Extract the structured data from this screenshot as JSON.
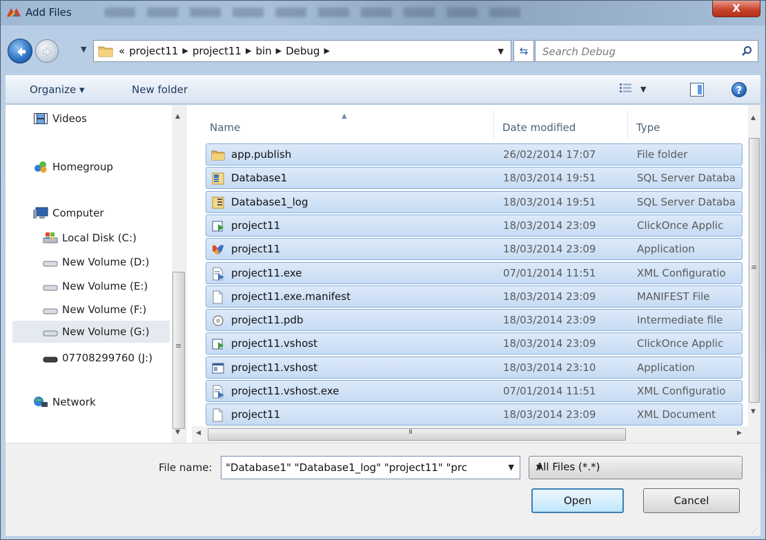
{
  "window": {
    "title": "Add Files",
    "close_label": "X"
  },
  "address": {
    "overflow": "«",
    "crumbs": [
      "project11",
      "project11",
      "bin",
      "Debug"
    ],
    "separator": "▶"
  },
  "search": {
    "placeholder": "Search Debug"
  },
  "toolbar": {
    "organize_label": "Organize ▾",
    "new_folder_label": "New folder",
    "help_label": "?"
  },
  "nav": {
    "items": [
      {
        "label": "Videos",
        "icon": "videos-icon"
      },
      {
        "label": "Homegroup",
        "icon": "homegroup-icon"
      },
      {
        "label": "Computer",
        "icon": "computer-icon"
      },
      {
        "label": "Local Disk (C:)",
        "icon": "local-disk-icon"
      },
      {
        "label": "New Volume (D:)",
        "icon": "drive-icon"
      },
      {
        "label": "New Volume (E:)",
        "icon": "drive-icon"
      },
      {
        "label": "New Volume (F:)",
        "icon": "drive-icon"
      },
      {
        "label": "New Volume (G:)",
        "icon": "drive-icon",
        "selected": true
      },
      {
        "label": "07708299760 (J:)",
        "icon": "removable-drive-icon"
      },
      {
        "label": "Network",
        "icon": "network-icon"
      }
    ]
  },
  "list": {
    "columns": {
      "name": "Name",
      "date": "Date modified",
      "type": "Type"
    },
    "rows": [
      {
        "name": "app.publish",
        "date": "26/02/2014 17:07",
        "type": "File folder",
        "icon": "folder-icon"
      },
      {
        "name": "Database1",
        "date": "18/03/2014 19:51",
        "type": "SQL Server Databa",
        "icon": "database-icon"
      },
      {
        "name": "Database1_log",
        "date": "18/03/2014 19:51",
        "type": "SQL Server Databa",
        "icon": "database-log-icon"
      },
      {
        "name": "project11",
        "date": "18/03/2014 23:09",
        "type": "ClickOnce Applic",
        "icon": "clickonce-icon"
      },
      {
        "name": "project11",
        "date": "18/03/2014 23:09",
        "type": "Application",
        "icon": "application-icon"
      },
      {
        "name": "project11.exe",
        "date": "07/01/2014 11:51",
        "type": "XML Configuratio",
        "icon": "config-file-icon"
      },
      {
        "name": "project11.exe.manifest",
        "date": "18/03/2014 23:09",
        "type": "MANIFEST File",
        "icon": "blank-file-icon"
      },
      {
        "name": "project11.pdb",
        "date": "18/03/2014 23:09",
        "type": "Intermediate file",
        "icon": "pdb-file-icon"
      },
      {
        "name": "project11.vshost",
        "date": "18/03/2014 23:09",
        "type": "ClickOnce Applic",
        "icon": "clickonce-icon"
      },
      {
        "name": "project11.vshost",
        "date": "18/03/2014 23:10",
        "type": "Application",
        "icon": "window-app-icon"
      },
      {
        "name": "project11.vshost.exe",
        "date": "07/01/2014 11:51",
        "type": "XML Configuratio",
        "icon": "config-file-icon"
      },
      {
        "name": "project11",
        "date": "18/03/2014 23:09",
        "type": "XML Document",
        "icon": "blank-file-icon"
      }
    ]
  },
  "footer": {
    "file_name_label": "File name:",
    "file_name_value": "\"Database1\" \"Database1_log\" \"project11\" \"prc",
    "filter_value": "All Files (*.*)",
    "open_label": "Open",
    "cancel_label": "Cancel"
  },
  "colors": {
    "selection": "#c6dbf3",
    "selection_border": "#84acdd",
    "close_button": "#c9442c"
  }
}
